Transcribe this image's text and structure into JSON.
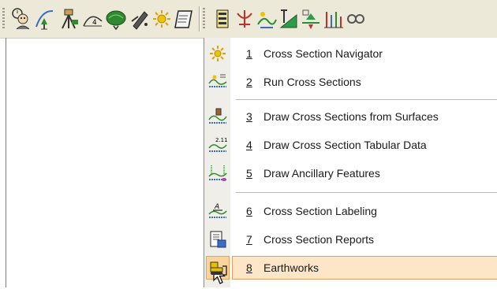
{
  "toolbar": {
    "left_group": [
      "people-tools-icon",
      "alignment-station-icon",
      "survey-equipment-icon",
      "profile-curve-icon",
      "surface-terrain-icon",
      "design-tools-icon",
      "cross-section-sun-icon",
      "notes-book-icon"
    ],
    "right_group": [
      "sheet-report-icon",
      "section-split-icon",
      "grading-icon",
      "slope-marker-icon",
      "earthwork-arrows-icon",
      "elevation-lines-icon",
      "more-tools-icon"
    ]
  },
  "menu": {
    "items": [
      {
        "number": "1",
        "label": "Cross Section Navigator",
        "icon": "navigator-sun-icon"
      },
      {
        "number": "2",
        "label": "Run Cross Sections",
        "icon": "run-sections-icon"
      },
      {
        "number": "3",
        "label": "Draw Cross Sections from Surfaces",
        "icon": "draw-surfaces-icon"
      },
      {
        "number": "4",
        "label": "Draw Cross Section Tabular Data",
        "icon": "tabular-data-icon"
      },
      {
        "number": "5",
        "label": "Draw Ancillary Features",
        "icon": "ancillary-features-icon"
      },
      {
        "number": "6",
        "label": "Cross Section Labeling",
        "icon": "labeling-icon"
      },
      {
        "number": "7",
        "label": "Cross Section Reports",
        "icon": "reports-icon"
      },
      {
        "number": "8",
        "label": "Earthworks",
        "icon": "earthworks-bulldozer-icon"
      }
    ],
    "highlighted_item": "8",
    "highlight_color": "#fde6c8",
    "highlight_border_color": "#e6a060"
  }
}
